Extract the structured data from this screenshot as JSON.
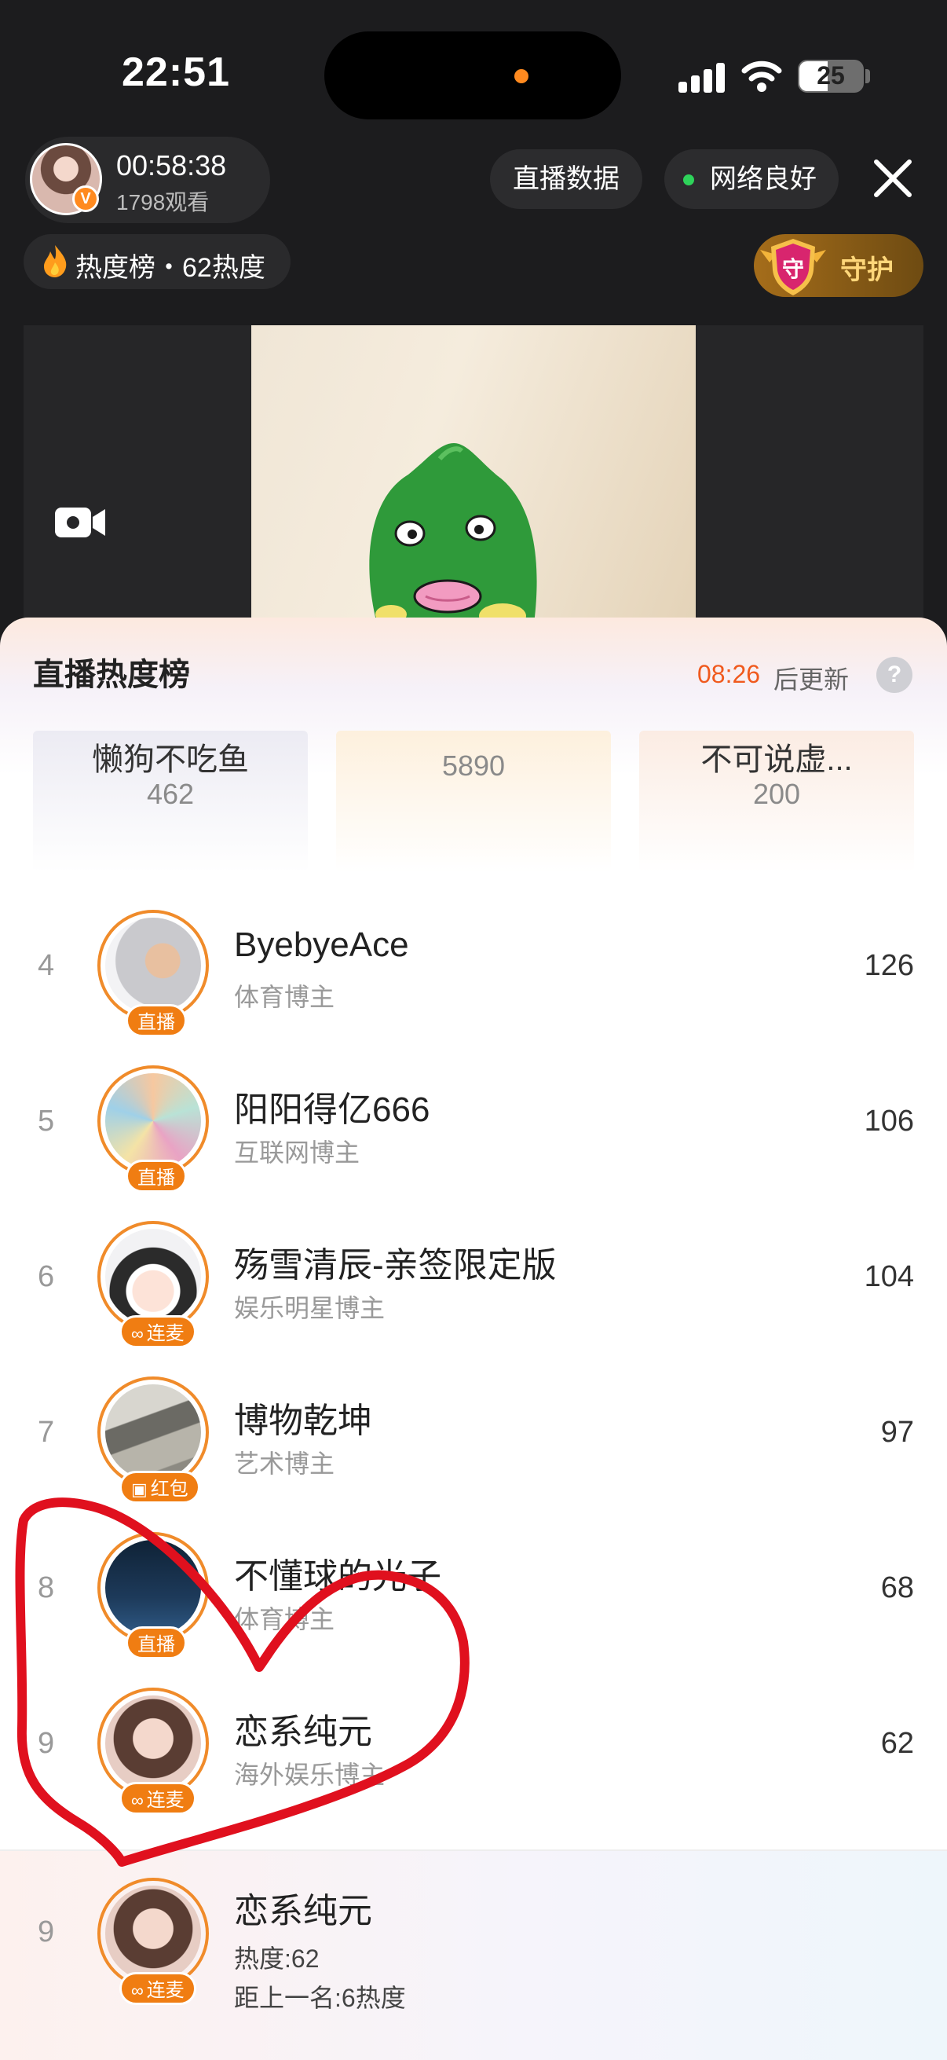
{
  "status_bar": {
    "time": "22:51",
    "battery": "25"
  },
  "live_header": {
    "duration": "00:58:38",
    "viewers": "1798观看",
    "data_button": "直播数据",
    "network_status": "网络良好",
    "heat_summary": "热度榜・62热度",
    "guard_button": "守护",
    "guard_shield_char": "守"
  },
  "ranking_sheet": {
    "title": "直播热度榜",
    "countdown": "08:26",
    "update_suffix": "后更新",
    "help": "?",
    "podium": [
      {
        "name": "懒狗不吃鱼",
        "score": "462"
      },
      {
        "name": "",
        "score": "5890"
      },
      {
        "name": "不可说虚...",
        "score": "200"
      }
    ],
    "rows": [
      {
        "rank": "4",
        "name": "ByebyeAce",
        "category": "体育博主",
        "score": "126",
        "tag": "直播",
        "tag_icon": ""
      },
      {
        "rank": "5",
        "name": "阳阳得亿666",
        "category": "互联网博主",
        "score": "106",
        "tag": "直播",
        "tag_icon": ""
      },
      {
        "rank": "6",
        "name": "殇雪清辰-亲签限定版",
        "category": "娱乐明星博主",
        "score": "104",
        "tag": "连麦",
        "tag_icon": "∞"
      },
      {
        "rank": "7",
        "name": "博物乾坤",
        "category": "艺术博主",
        "score": "97",
        "tag": "红包",
        "tag_icon": "▣"
      },
      {
        "rank": "8",
        "name": "不懂球的光子",
        "category": "体育博主",
        "score": "68",
        "tag": "直播",
        "tag_icon": ""
      },
      {
        "rank": "9",
        "name": "恋系纯元",
        "category": "海外娱乐博主",
        "score": "62",
        "tag": "连麦",
        "tag_icon": "∞"
      }
    ],
    "mine": {
      "rank": "9",
      "name": "恋系纯元",
      "heat": "热度:62",
      "gap": "距上一名:6热度",
      "tag": "连麦",
      "tag_icon": "∞"
    }
  },
  "colors": {
    "accent_orange": "#f07d12",
    "countdown_red": "#f05a1e",
    "annotation_red": "#e0101e",
    "network_green": "#2ed35a"
  }
}
